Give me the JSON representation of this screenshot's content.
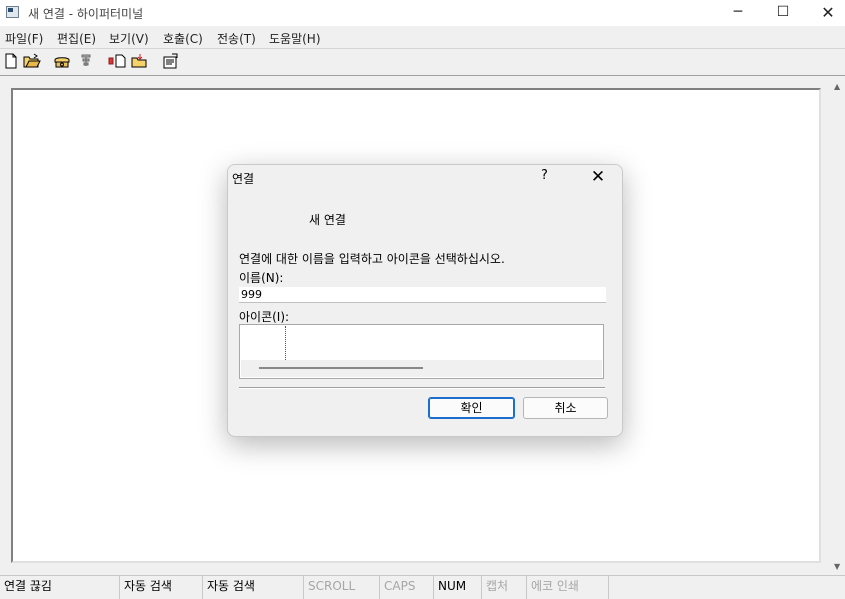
{
  "window": {
    "title": "새 연결 - 하이퍼터미널",
    "minimize": "─",
    "maximize": "☐",
    "close": "✕"
  },
  "menu": [
    {
      "label": "파일(F)"
    },
    {
      "label": "편집(E)"
    },
    {
      "label": "보기(V)"
    },
    {
      "label": "호출(C)"
    },
    {
      "label": "전송(T)"
    },
    {
      "label": "도움말(H)"
    }
  ],
  "toolbar": {
    "icons": [
      "new-file-icon",
      "open-folder-icon",
      "call-icon",
      "disconnect-icon",
      "send-icon",
      "receive-icon",
      "properties-icon"
    ]
  },
  "dialog": {
    "title": "연결",
    "help": "?",
    "close": "✕",
    "heading": "새 연결",
    "prompt": "연결에 대한 이름을 입력하고 아이콘을 선택하십시오.",
    "name_label": "이름(N):",
    "name_value": "999",
    "icon_label": "아이콘(I):",
    "ok_label": "확인",
    "cancel_label": "취소"
  },
  "status": [
    {
      "text": "연결 끊김",
      "dim": false
    },
    {
      "text": "자동 검색",
      "dim": false
    },
    {
      "text": "자동 검색",
      "dim": false
    },
    {
      "text": "SCROLL",
      "dim": true
    },
    {
      "text": "CAPS",
      "dim": true
    },
    {
      "text": "NUM",
      "dim": false
    },
    {
      "text": "캡처",
      "dim": true
    },
    {
      "text": "에코 인쇄",
      "dim": true
    }
  ],
  "colors": {
    "ok_border": "#1b6ecc",
    "dim_text": "#a6a6a6"
  }
}
